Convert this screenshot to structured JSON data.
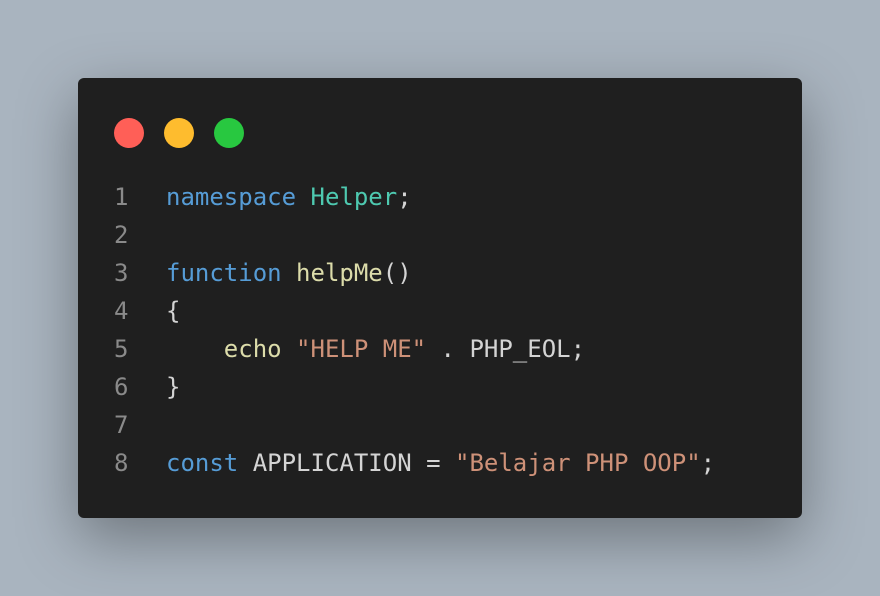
{
  "window": {
    "controls": [
      {
        "name": "close",
        "color": "#ff5f57"
      },
      {
        "name": "minimize",
        "color": "#febc2e"
      },
      {
        "name": "maximize",
        "color": "#28c840"
      }
    ]
  },
  "code": {
    "language": "php",
    "lines": [
      {
        "number": "1",
        "tokens": [
          [
            "kw",
            "namespace"
          ],
          [
            "pl",
            " "
          ],
          [
            "cls",
            "Helper"
          ],
          [
            "pl",
            ";"
          ]
        ]
      },
      {
        "number": "2",
        "tokens": []
      },
      {
        "number": "3",
        "tokens": [
          [
            "kw",
            "function"
          ],
          [
            "pl",
            " "
          ],
          [
            "fn",
            "helpMe"
          ],
          [
            "pl",
            "()"
          ]
        ]
      },
      {
        "number": "4",
        "tokens": [
          [
            "pl",
            "{"
          ]
        ]
      },
      {
        "number": "5",
        "tokens": [
          [
            "pl",
            "    "
          ],
          [
            "fn",
            "echo"
          ],
          [
            "pl",
            " "
          ],
          [
            "str",
            "\"HELP ME\""
          ],
          [
            "pl",
            " . PHP_EOL;"
          ]
        ]
      },
      {
        "number": "6",
        "tokens": [
          [
            "pl",
            "}"
          ]
        ]
      },
      {
        "number": "7",
        "tokens": []
      },
      {
        "number": "8",
        "tokens": [
          [
            "kw",
            "const"
          ],
          [
            "pl",
            " APPLICATION = "
          ],
          [
            "str",
            "\"Belajar PHP OOP\""
          ],
          [
            "pl",
            ";"
          ]
        ]
      }
    ]
  }
}
